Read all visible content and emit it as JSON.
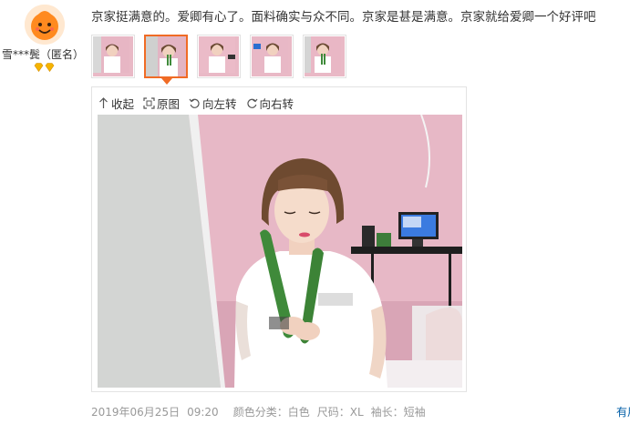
{
  "reviewer": {
    "username": "雪***鬓（匿名）",
    "avatar_icon": "orange-mascot-avatar",
    "level_icon": "gold-diamond-icon",
    "level_count": 2
  },
  "review": {
    "text": "京家挺满意的。爱卿有心了。面料确实与众不同。京家是甚是满意。京家就给爱卿一个好评吧",
    "thumbnail_count": 5,
    "active_thumbnail_index": 1
  },
  "viewer": {
    "collapse_label": "收起",
    "original_label": "原图",
    "rotate_left_label": "向左转",
    "rotate_right_label": "向右转"
  },
  "meta": {
    "date": "2019年06月25日",
    "time": "09:20",
    "color_label": "颜色分类：",
    "color_value": "白色",
    "size_label": "尺码：",
    "size_value": "XL",
    "sleeve_label": "袖长：",
    "sleeve_value": "短袖"
  },
  "edge_link": {
    "text": "有用"
  },
  "colors": {
    "accent_orange": "#f06b25",
    "link_blue": "#005ea7",
    "meta_gray": "#999999",
    "diamond_gold": "#f5b400"
  }
}
